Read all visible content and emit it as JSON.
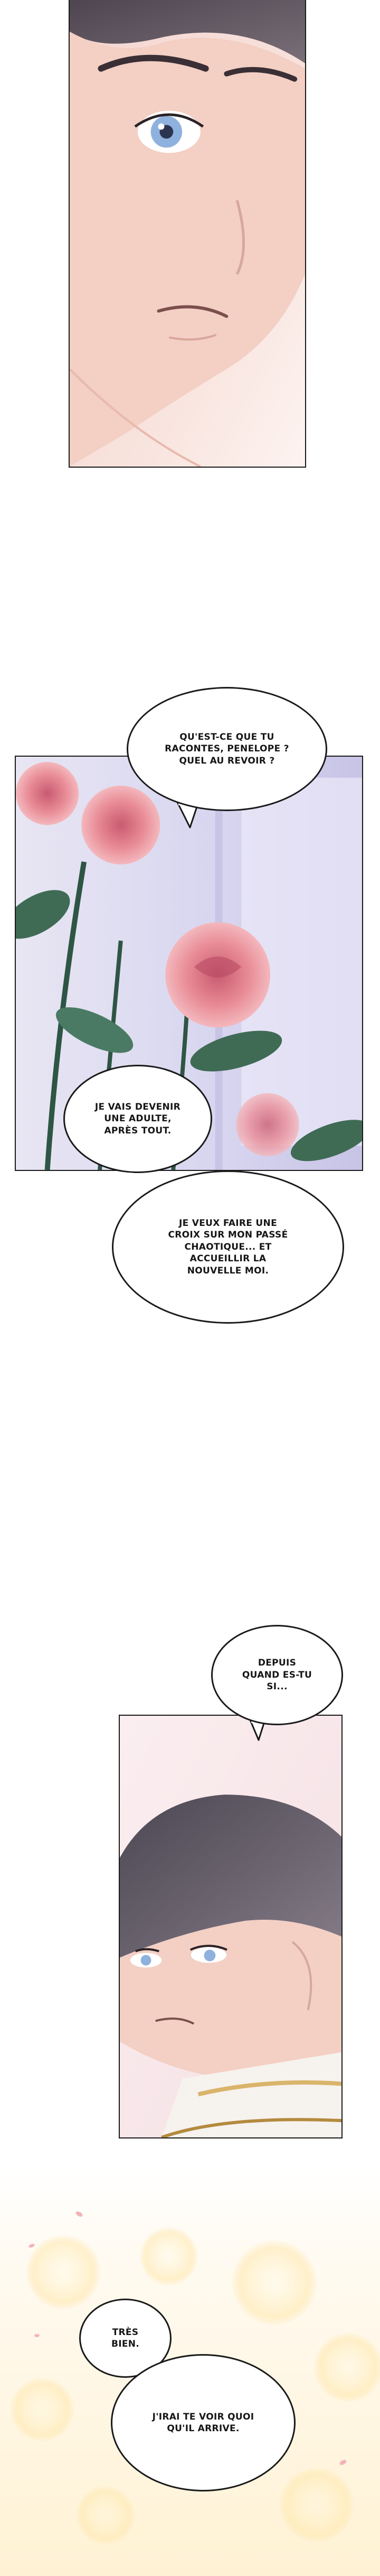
{
  "colors": {
    "ink": "#1a1a1a",
    "paper": "#ffffff",
    "skin": "#f6d9cf",
    "hair": "#5a4f55",
    "rose": "#e98c97",
    "leaf": "#3f6b55",
    "window": "#cfd3ee",
    "glow": "#fff4c8"
  },
  "bubbles": {
    "b1": "QU'EST-CE QUE TU RACONTES, PENELOPE ? QUEL AU REVOIR ?",
    "b2": "JE VAIS DEVENIR UNE ADULTE, APRÈS TOUT.",
    "b3": "JE VEUX FAIRE UNE CROIX SUR MON PASSÉ CHAOTIQUE... ET ACCUEILLIR LA NOUVELLE MOI.",
    "b4": "DEPUIS QUAND ES-TU SI...",
    "b5": "TRÈS BIEN.",
    "b6": "J'IRAI TE VOIR QUOI QU'IL ARRIVE."
  }
}
